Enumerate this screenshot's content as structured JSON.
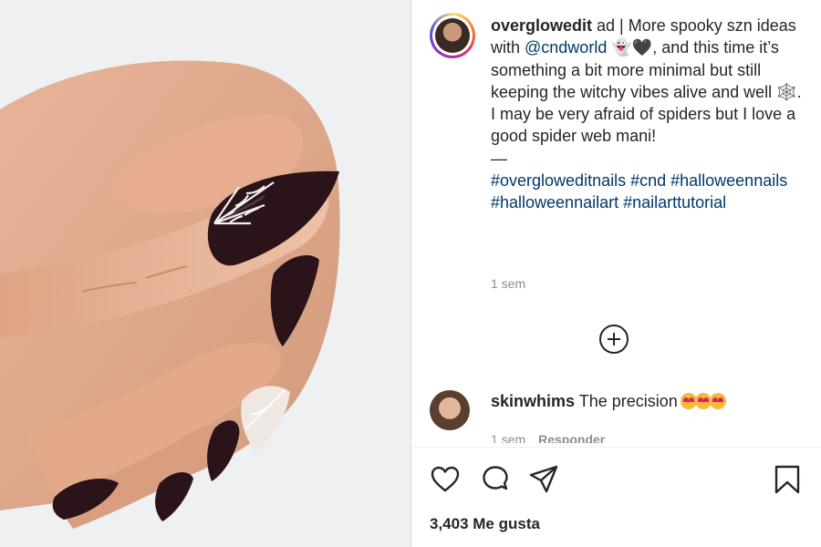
{
  "post": {
    "username": "overglowedit",
    "caption_text_1": " ad | More spooky szn ideas with ",
    "mention": "@cndworld",
    "ghost_emoji": "👻",
    "heart_emoji": "🖤",
    "caption_text_2": ", and this time it’s something a bit more minimal but still keeping the witchy vibes alive and well ",
    "web_emoji": "🕸️",
    "caption_text_3": ". I may be very afraid of spiders but I love a good spider web mani!",
    "dash": "—",
    "hashtags": "#overglowe​ditnails #cnd #halloweennails #halloweennailart #nailarttutorial",
    "time": "1 sem"
  },
  "comment": {
    "username": "skinwhims",
    "text": "The precision",
    "time": "1 sem",
    "reply_label": "Responder"
  },
  "actions": {
    "like": "heart-icon",
    "comment": "comment-icon",
    "share": "paper-plane-icon",
    "save": "bookmark-icon"
  },
  "likes_text": "3,403 Me gusta",
  "colors": {
    "link": "#00376b",
    "muted": "#8e8e8e",
    "text": "#262626",
    "nail": "#2a1419"
  }
}
